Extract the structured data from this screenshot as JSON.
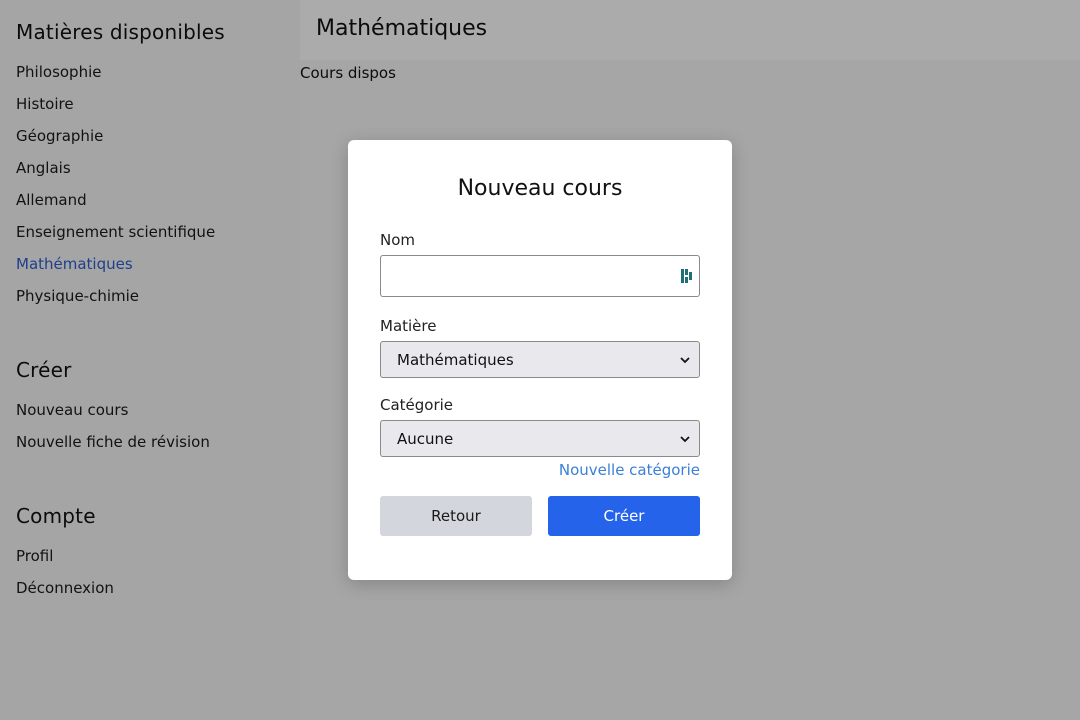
{
  "sidebar": {
    "subjects_heading": "Matières disponibles",
    "subjects": [
      {
        "label": "Philosophie"
      },
      {
        "label": "Histoire"
      },
      {
        "label": "Géographie"
      },
      {
        "label": "Anglais"
      },
      {
        "label": "Allemand"
      },
      {
        "label": "Enseignement scientifique"
      },
      {
        "label": "Mathématiques",
        "active": true
      },
      {
        "label": "Physique-chimie"
      }
    ],
    "create_heading": "Créer",
    "create_items": [
      {
        "label": "Nouveau cours"
      },
      {
        "label": "Nouvelle fiche de révision"
      }
    ],
    "account_heading": "Compte",
    "account_items": [
      {
        "label": "Profil"
      },
      {
        "label": "Déconnexion"
      }
    ]
  },
  "main": {
    "title": "Mathématiques",
    "subtitle": "Cours dispos"
  },
  "modal": {
    "title": "Nouveau cours",
    "name_label": "Nom",
    "name_value": "",
    "subject_label": "Matière",
    "subject_selected": "Mathématiques",
    "category_label": "Catégorie",
    "category_selected": "Aucune",
    "new_category_link": "Nouvelle catégorie",
    "back_button": "Retour",
    "create_button": "Créer"
  },
  "colors": {
    "accent": "#2563eb",
    "link": "#3b7fd6",
    "active_nav": "#2f5fd0"
  },
  "icons": {
    "name_field_icon": "password-manager-icon",
    "select_icon": "chevron-down-icon"
  }
}
